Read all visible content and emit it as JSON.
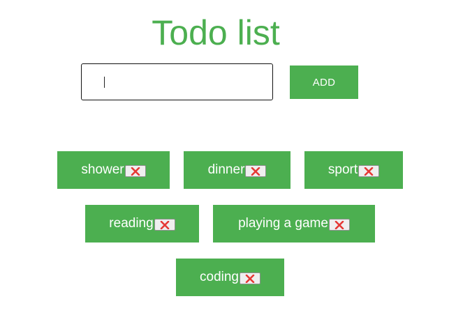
{
  "header": {
    "title": "Todo list"
  },
  "form": {
    "input_value": "",
    "input_placeholder": "",
    "add_label": "ADD"
  },
  "todos": [
    {
      "label": "shower"
    },
    {
      "label": "dinner"
    },
    {
      "label": "sport"
    },
    {
      "label": "reading"
    },
    {
      "label": "playing a game"
    },
    {
      "label": "coding"
    }
  ],
  "icons": {
    "delete": "close-x-icon"
  },
  "colors": {
    "accent": "#4caf50",
    "delete_icon": "#e53935",
    "text_on_accent": "#ffffff"
  }
}
